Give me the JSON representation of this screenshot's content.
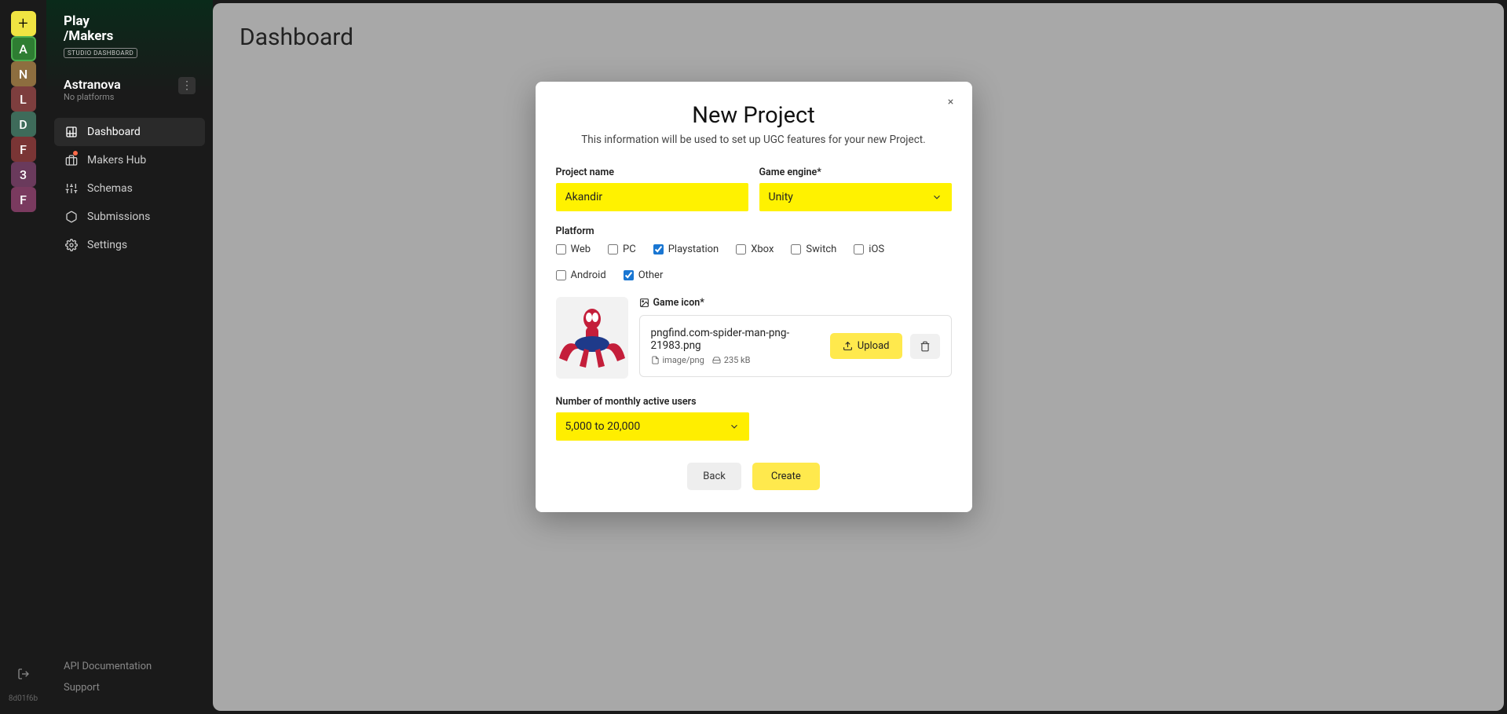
{
  "rail": {
    "items": [
      {
        "label": "+",
        "cls": "rail-add"
      },
      {
        "label": "A",
        "cls": "rail-a"
      },
      {
        "label": "N",
        "cls": "rail-n"
      },
      {
        "label": "L",
        "cls": "rail-l"
      },
      {
        "label": "D",
        "cls": "rail-d"
      },
      {
        "label": "F",
        "cls": "rail-f1"
      },
      {
        "label": "3",
        "cls": "rail-3"
      },
      {
        "label": "F",
        "cls": "rail-f2"
      }
    ],
    "version": "8d01f6b"
  },
  "logo": {
    "line1": "Play",
    "line2": "/Makers",
    "badge": "STUDIO DASHBOARD"
  },
  "workspace": {
    "name": "Astranova",
    "sub": "No platforms"
  },
  "nav": {
    "items": [
      {
        "label": "Dashboard",
        "icon": "dashboard-icon",
        "active": true
      },
      {
        "label": "Makers Hub",
        "icon": "hub-icon",
        "dot": true
      },
      {
        "label": "Schemas",
        "icon": "schemas-icon"
      },
      {
        "label": "Submissions",
        "icon": "submissions-icon"
      },
      {
        "label": "Settings",
        "icon": "settings-icon"
      }
    ]
  },
  "footer": {
    "api": "API Documentation",
    "support": "Support"
  },
  "page": {
    "title": "Dashboard"
  },
  "dialog": {
    "title": "New Project",
    "sub": "This information will be used to set up UGC features for your new Project.",
    "project_name_label": "Project name",
    "project_name_value": "Akandir",
    "engine_label": "Game engine*",
    "engine_value": "Unity",
    "platform_label": "Platform",
    "platforms": [
      {
        "label": "Web",
        "checked": false
      },
      {
        "label": "PC",
        "checked": false
      },
      {
        "label": "Playstation",
        "checked": true
      },
      {
        "label": "Xbox",
        "checked": false
      },
      {
        "label": "Switch",
        "checked": false
      },
      {
        "label": "iOS",
        "checked": false
      },
      {
        "label": "Android",
        "checked": false
      },
      {
        "label": "Other",
        "checked": true
      }
    ],
    "icon_label": "Game icon*",
    "file_name": "pngfind.com-spider-man-png-21983.png",
    "file_type": "image/png",
    "file_size": "235 kB",
    "upload_label": "Upload",
    "mau_label": "Number of monthly active users",
    "mau_value": "5,000 to 20,000",
    "back_label": "Back",
    "create_label": "Create"
  }
}
